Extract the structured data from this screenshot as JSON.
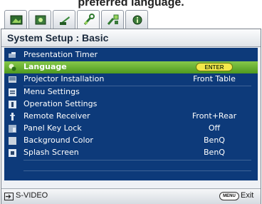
{
  "caption": "preferred language.",
  "tabs": [
    {
      "icon": "picture-icon"
    },
    {
      "icon": "advanced-picture-icon"
    },
    {
      "icon": "display-icon"
    },
    {
      "icon": "system-setup-basic-icon",
      "active": true
    },
    {
      "icon": "system-setup-advanced-icon"
    },
    {
      "icon": "information-icon"
    }
  ],
  "page_title": "System Setup : Basic",
  "menu": {
    "items": [
      {
        "label": "Presentation Timer",
        "value": "",
        "icon": "timer-icon"
      },
      {
        "label": "Language",
        "value": "ENTER",
        "icon": "language-icon",
        "selected": true
      },
      {
        "label": "Projector Installation",
        "value": "Front Table",
        "icon": "projector-icon"
      },
      {
        "label": "Menu Settings",
        "value": "",
        "icon": "menu-settings-icon"
      },
      {
        "label": "Operation Settings",
        "value": "",
        "icon": "operation-settings-icon"
      },
      {
        "label": "Remote Receiver",
        "value": "Front+Rear",
        "icon": "remote-receiver-icon"
      },
      {
        "label": "Panel Key Lock",
        "value": "Off",
        "icon": "panel-key-lock-icon"
      },
      {
        "label": "Background Color",
        "value": "BenQ",
        "icon": "background-color-icon"
      },
      {
        "label": "Splash Screen",
        "value": "BenQ",
        "icon": "splash-screen-icon"
      }
    ]
  },
  "footer": {
    "source_label": "S-VIDEO",
    "menu_key_label": "MENU",
    "exit_label": "Exit"
  },
  "colors": {
    "menu_background": "#0d3a7a",
    "selected_row": "#6fb63a",
    "enter_pill": "#f3e84a"
  }
}
